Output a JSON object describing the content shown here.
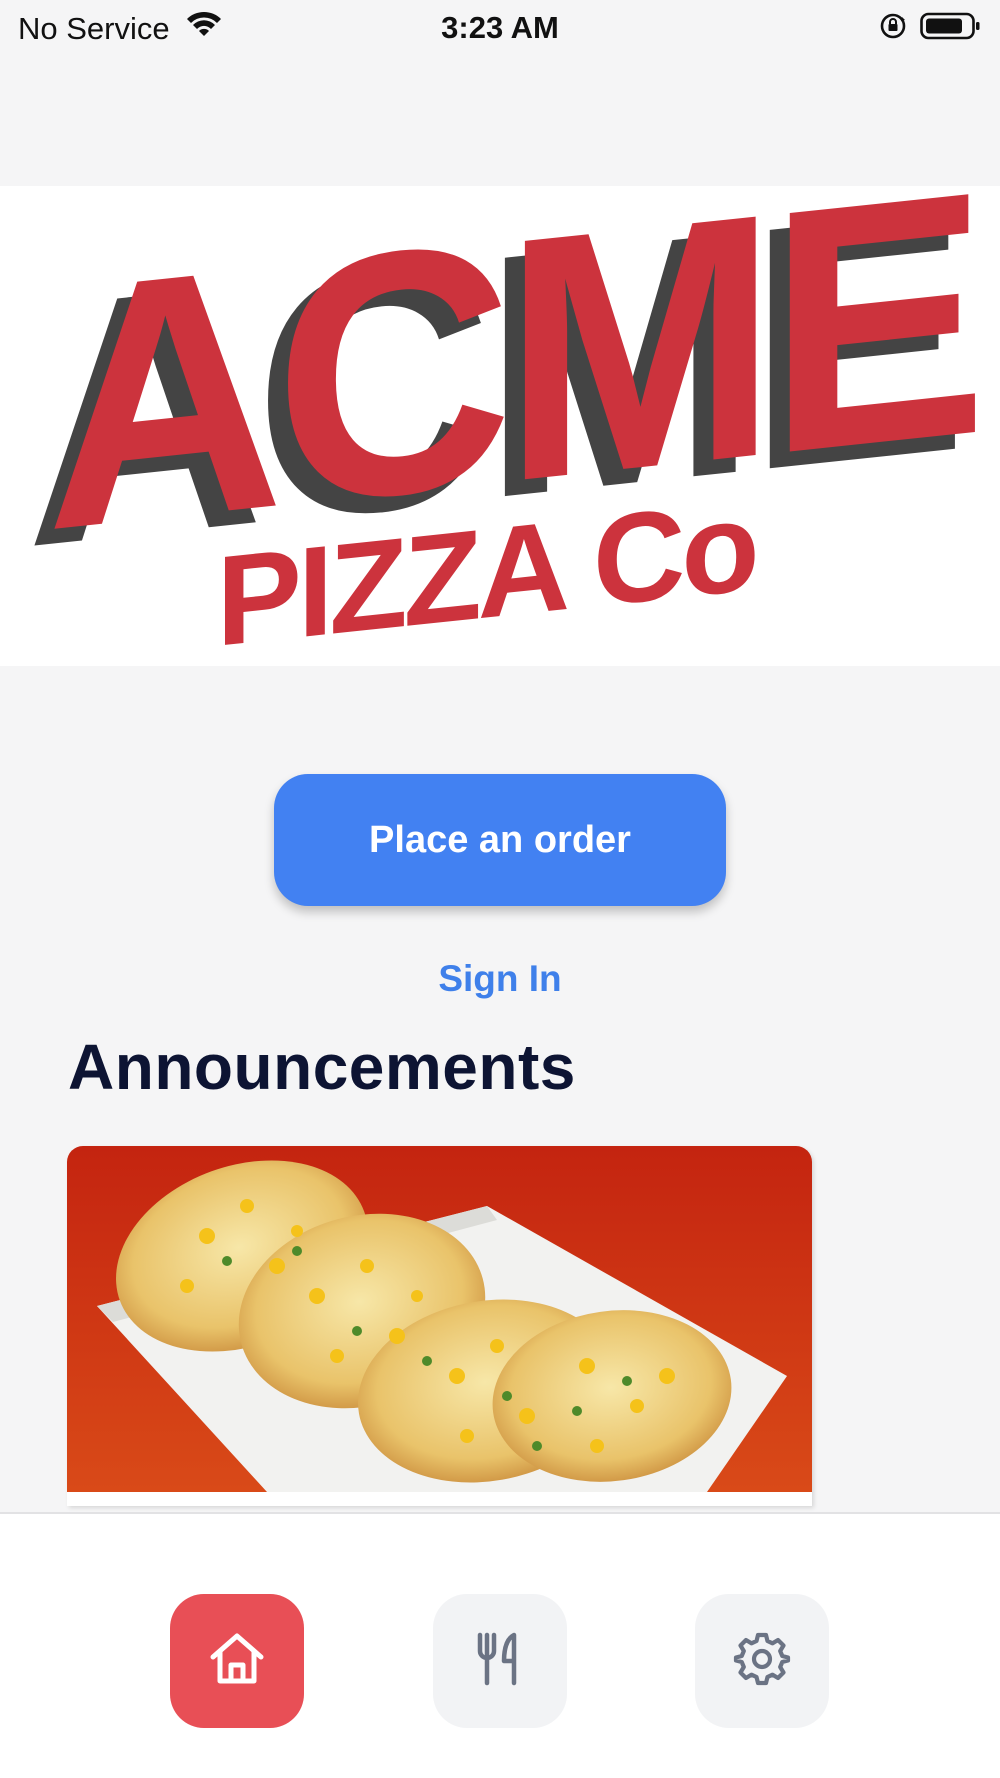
{
  "status_bar": {
    "carrier": "No Service",
    "time": "3:23 AM"
  },
  "logo": {
    "text_main": "ACME",
    "text_sub": "PIZZA Co",
    "colors": {
      "red": "#cc333d",
      "shadow": "#444444"
    }
  },
  "main": {
    "order_button_label": "Place an order",
    "sign_in_label": "Sign In",
    "announcements_title": "Announcements"
  },
  "announcements": [
    {
      "image": "cheese-corn-garlic-bread-photo"
    }
  ],
  "tab_bar": {
    "tabs": [
      {
        "icon": "home-icon",
        "active": true
      },
      {
        "icon": "fork-knife-icon",
        "active": false
      },
      {
        "icon": "gear-icon",
        "active": false
      }
    ]
  },
  "colors": {
    "accent_blue": "#4281f2",
    "active_tab": "#e84f56",
    "heading": "#0d1433"
  }
}
